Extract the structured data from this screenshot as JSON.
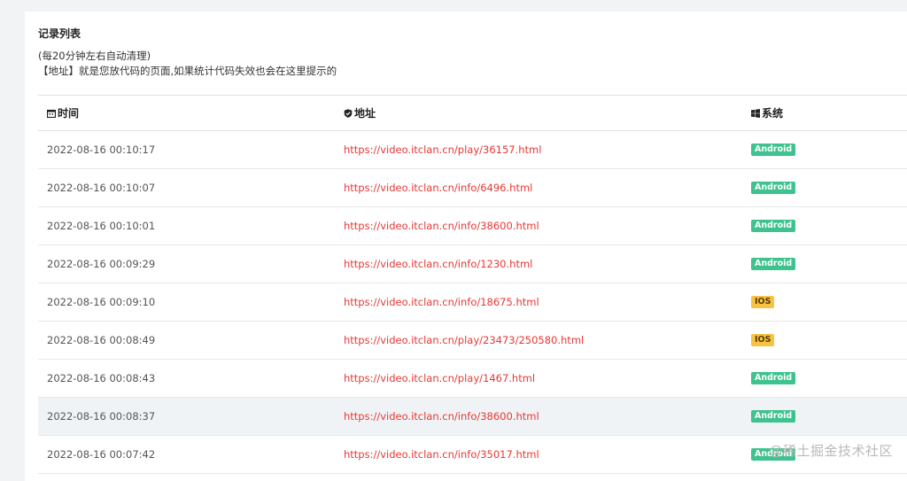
{
  "panel": {
    "title": "记录列表",
    "note1": "(每20分钟左右自动清理)",
    "note2": "【地址】就是您放代码的页面,如果统计代码失效也会在这里提示的"
  },
  "table": {
    "headers": {
      "time": "时间",
      "address": "地址",
      "system": "系统"
    },
    "rows": [
      {
        "time": "2022-08-16 00:10:17",
        "url": "https://video.itclan.cn/play/36157.html",
        "system": "Android"
      },
      {
        "time": "2022-08-16 00:10:07",
        "url": "https://video.itclan.cn/info/6496.html",
        "system": "Android"
      },
      {
        "time": "2022-08-16 00:10:01",
        "url": "https://video.itclan.cn/info/38600.html",
        "system": "Android"
      },
      {
        "time": "2022-08-16 00:09:29",
        "url": "https://video.itclan.cn/info/1230.html",
        "system": "Android"
      },
      {
        "time": "2022-08-16 00:09:10",
        "url": "https://video.itclan.cn/info/18675.html",
        "system": "IOS"
      },
      {
        "time": "2022-08-16 00:08:49",
        "url": "https://video.itclan.cn/play/23473/250580.html",
        "system": "IOS"
      },
      {
        "time": "2022-08-16 00:08:43",
        "url": "https://video.itclan.cn/play/1467.html",
        "system": "Android"
      },
      {
        "time": "2022-08-16 00:08:37",
        "url": "https://video.itclan.cn/info/38600.html",
        "system": "Android"
      },
      {
        "time": "2022-08-16 00:07:42",
        "url": "https://video.itclan.cn/info/35017.html",
        "system": "Android"
      }
    ]
  },
  "watermark": "@稀土掘金技术社区",
  "colors": {
    "url": "#e53935",
    "android": "#3ec38e",
    "ios": "#f6c343"
  },
  "icons": {
    "time": "calendar-icon",
    "address": "shield-check-icon",
    "system": "windows-icon"
  }
}
